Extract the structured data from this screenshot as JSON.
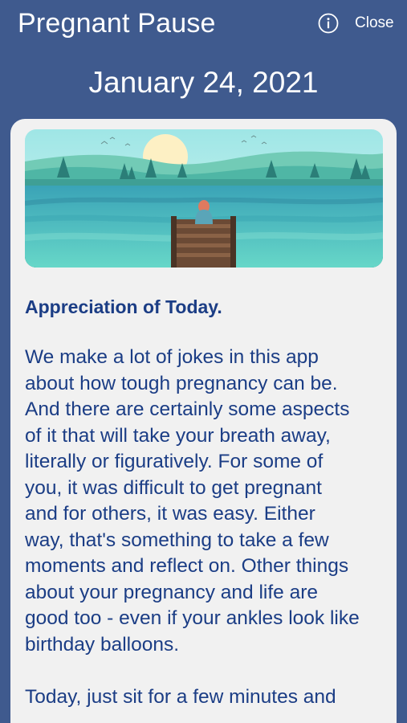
{
  "header": {
    "app_title": "Pregnant Pause",
    "info_icon": "info-icon",
    "close_label": "Close"
  },
  "date": "January 24, 2021",
  "article": {
    "image_icon": "lake-dock-illustration",
    "title": "Appreciation of Today.",
    "body": "We make a lot of jokes in this app\nabout how tough pregnancy can be.\nAnd there are certainly some aspects\nof it that will take your breath away,\nliterally or figuratively.  For some of\nyou, it was difficult to get pregnant\nand for others, it was easy.  Either\nway, that's something to take a few\nmoments and reflect on.  Other things\nabout your pregnancy and life are\ngood too - even if your ankles look like\nbirthday balloons.\n\nToday, just sit for a few minutes and"
  },
  "colors": {
    "background": "#3f5a8e",
    "card": "#f1f1f1",
    "text": "#1b3d85"
  }
}
